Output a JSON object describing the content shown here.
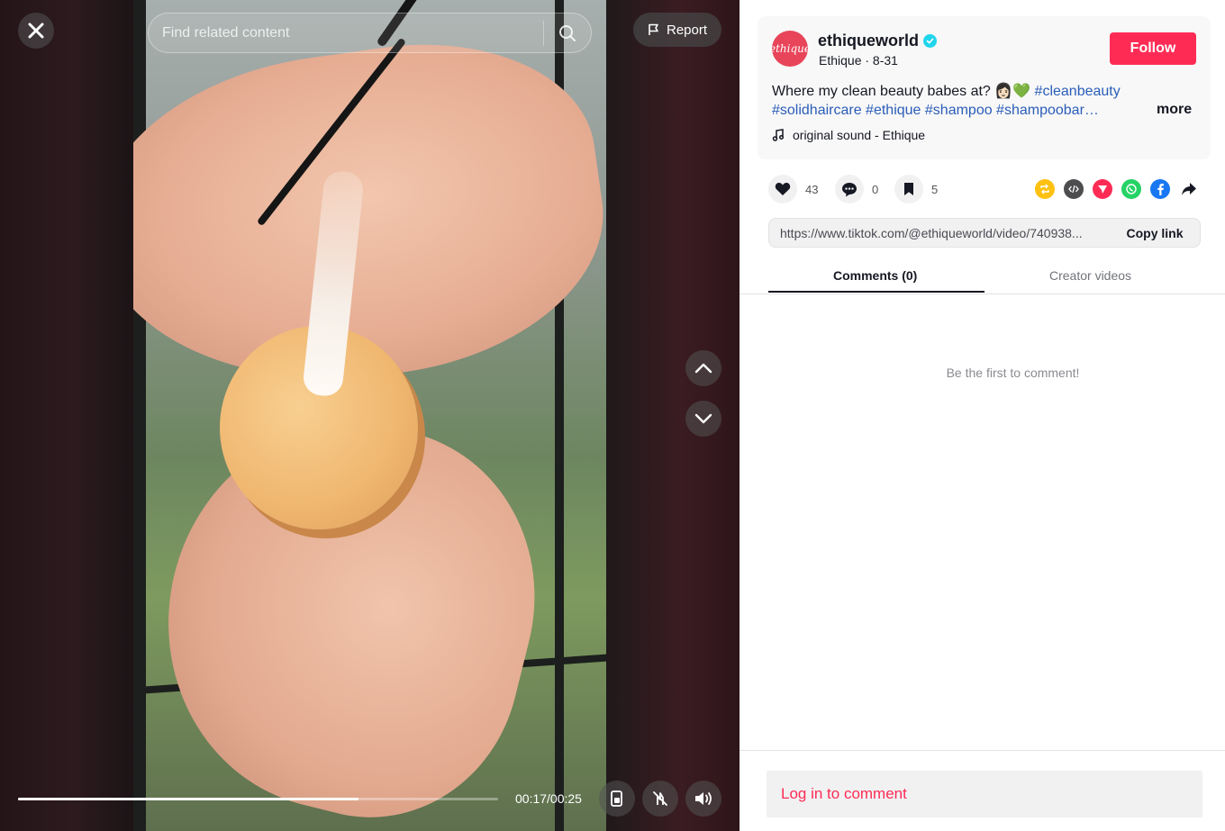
{
  "player": {
    "search_placeholder": "Find related content",
    "report_label": "Report",
    "time": "00:17/00:25",
    "progress_fraction": 0.71
  },
  "post": {
    "avatar_text": "ethique",
    "username": "ethiqueworld",
    "display_name_date": "Ethique · 8-31",
    "follow_label": "Follow",
    "caption": "Where my clean beauty babes at? 👩🏻💚",
    "hashtag_1": "#cleanbeauty",
    "hashtags_line2": "#solidhaircare #ethique #shampoo #shampoobar…",
    "more_label": "more",
    "sound": "original sound - Ethique"
  },
  "stats": {
    "likes": "43",
    "comments": "0",
    "saves": "5"
  },
  "share": {
    "url": "https://www.tiktok.com/@ethiqueworld/video/740938...",
    "copy_label": "Copy link",
    "icons": [
      "repost-icon",
      "embed-icon",
      "send-icon",
      "whatsapp-icon",
      "facebook-icon",
      "share-arrow-icon"
    ]
  },
  "tabs": {
    "comments": "Comments (0)",
    "creator": "Creator videos"
  },
  "comments": {
    "empty": "Be the first to comment!",
    "login": "Log in to comment"
  },
  "colors": {
    "brand": "#fe2c55",
    "hashtag": "#2b5db9",
    "verified": "#20d5ec"
  }
}
